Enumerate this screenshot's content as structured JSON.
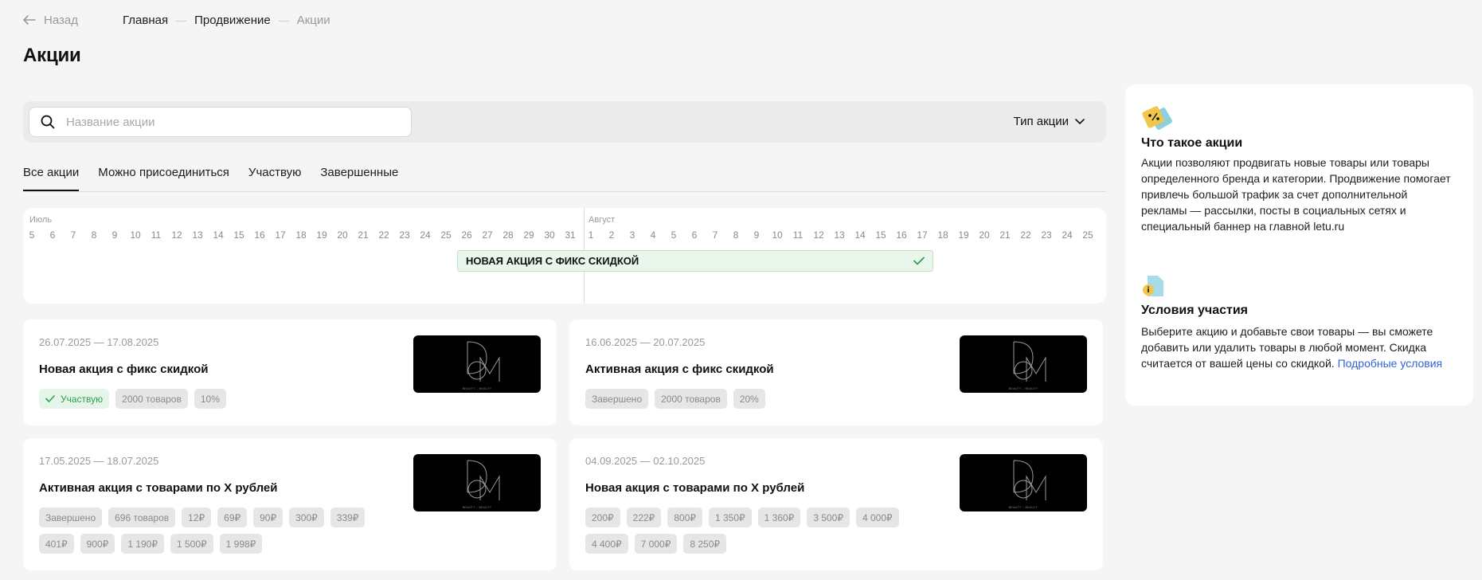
{
  "nav": {
    "back_label": "Назад",
    "breadcrumbs": [
      "Главная",
      "Продвижение",
      "Акции"
    ]
  },
  "page_title": "Акции",
  "filters": {
    "search_placeholder": "Название акции",
    "type_select_label": "Тип акции"
  },
  "tabs": [
    "Все акции",
    "Можно присоединиться",
    "Участвую",
    "Завершенные"
  ],
  "active_tab": "Все акции",
  "timeline": {
    "months": [
      "Июль",
      "Август"
    ],
    "july_days": [
      "5",
      "6",
      "7",
      "8",
      "9",
      "10",
      "11",
      "12",
      "13",
      "14",
      "15",
      "16",
      "17",
      "18",
      "19",
      "20",
      "21",
      "22",
      "23",
      "24",
      "25",
      "26",
      "27",
      "28",
      "29",
      "30",
      "31"
    ],
    "august_days": [
      "1",
      "2",
      "3",
      "4",
      "5",
      "6",
      "7",
      "8",
      "9",
      "10",
      "11",
      "12",
      "13",
      "14",
      "15",
      "16",
      "17",
      "18",
      "19",
      "20",
      "21",
      "22",
      "23",
      "24",
      "25",
      "2"
    ],
    "bar_label": "НОВАЯ АКЦИЯ С ФИКС СКИДКОЙ",
    "bar_start": "26.07",
    "bar_end": "17.08"
  },
  "promos": [
    {
      "dates": "26.07.2025 — 17.08.2025",
      "title": "Новая акция с фикс скидкой",
      "tags": [
        "Участвую",
        "2000 товаров",
        "10%"
      ],
      "participating": true
    },
    {
      "dates": "16.06.2025 — 20.07.2025",
      "title": "Активная акция с фикс скидкой",
      "tags": [
        "Завершено",
        "2000 товаров",
        "20%"
      ],
      "participating": false
    },
    {
      "dates": "17.05.2025 — 18.07.2025",
      "title": "Активная акция с товарами по X рублей",
      "tags": [
        "Завершено",
        "696 товаров",
        "12₽",
        "69₽",
        "90₽",
        "300₽",
        "339₽",
        "401₽",
        "900₽",
        "1 190₽",
        "1 500₽",
        "1 998₽"
      ],
      "participating": false
    },
    {
      "dates": "04.09.2025 — 02.10.2025",
      "title": "Новая акция с товарами по X рублей",
      "tags": [
        "200₽",
        "222₽",
        "800₽",
        "1 350₽",
        "1 360₽",
        "3 500₽",
        "4 000₽",
        "4 400₽",
        "7 000₽",
        "8 250₽"
      ],
      "participating": false
    }
  ],
  "thumb_caption": "BEAUTY ∴ BEAUTY",
  "sidebar": {
    "what_title": "Что такое акции",
    "what_text": "Акции позволяют продвигать новые товары или товары определенного бренда и категории. Продвижение помогает привлечь большой трафик за счет дополнительной рекламы — рассылки, посты в социальных сетях и специальный баннер на главной letu.ru",
    "cond_title": "Условия участия",
    "cond_text": "Выберите акцию и добавьте свои товары — вы сможете добавить или удалить товары в любой момент. Скидка считается от вашей цены со скидкой.",
    "cond_link": "Подробные условия"
  },
  "colors": {
    "accent_green": "#2e9e4a",
    "link_blue": "#2f63d8",
    "tag_bg": "#e6e6e6"
  }
}
